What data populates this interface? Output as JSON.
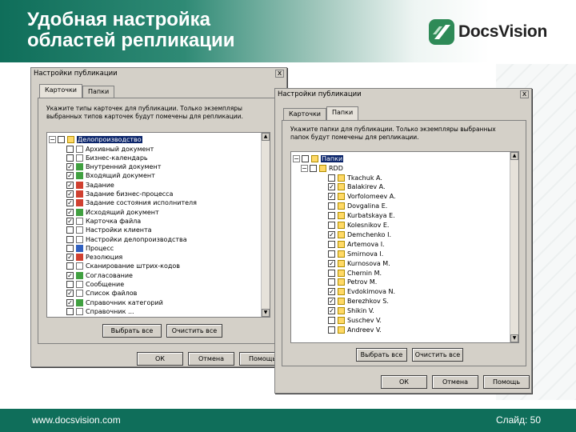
{
  "slide": {
    "title_lines": [
      "Удобная настройка",
      "областей репликации"
    ],
    "logo_text": "DocsVision",
    "footer_url": "www.docsvision.com",
    "footer_page": "Слайд: 50",
    "colors": {
      "brand_green": "#0f6e5a",
      "selection": "#0a246a"
    }
  },
  "dialog_cards": {
    "title": "Настройки публикации",
    "close": "x",
    "tabs": [
      "Карточки",
      "Папки"
    ],
    "active_tab": 0,
    "hint": "Укажите типы карточек для публикации. Только экземпляры выбранных типов карточек будут помечены для репликации.",
    "tree_root": "Делопроизводство",
    "items": [
      {
        "label": "Архивный документ",
        "checked": false,
        "icon": "doc"
      },
      {
        "label": "Бизнес-календарь",
        "checked": false,
        "icon": "doc"
      },
      {
        "label": "Внутренний документ",
        "checked": true,
        "icon": "grn"
      },
      {
        "label": "Входящий документ",
        "checked": true,
        "icon": "grn"
      },
      {
        "label": "Задание",
        "checked": true,
        "icon": "red"
      },
      {
        "label": "Задание бизнес-процесса",
        "checked": true,
        "icon": "red"
      },
      {
        "label": "Задание состояния исполнителя",
        "checked": true,
        "icon": "red"
      },
      {
        "label": "Исходящий документ",
        "checked": true,
        "icon": "grn"
      },
      {
        "label": "Карточка файла",
        "checked": true,
        "icon": "doc"
      },
      {
        "label": "Настройки клиента",
        "checked": false,
        "icon": "doc"
      },
      {
        "label": "Настройки делопроизводства",
        "checked": false,
        "icon": "doc"
      },
      {
        "label": "Процесс",
        "checked": false,
        "icon": "blu"
      },
      {
        "label": "Резолюция",
        "checked": true,
        "icon": "red"
      },
      {
        "label": "Сканирование штрих-кодов",
        "checked": false,
        "icon": "doc"
      },
      {
        "label": "Согласование",
        "checked": true,
        "icon": "grn"
      },
      {
        "label": "Сообщение",
        "checked": false,
        "icon": "doc"
      },
      {
        "label": "Список файлов",
        "checked": true,
        "icon": "doc"
      },
      {
        "label": "Справочник категорий",
        "checked": true,
        "icon": "grn"
      },
      {
        "label": "Справочник ...",
        "checked": false,
        "icon": "doc"
      }
    ],
    "select_all": "Выбрать все",
    "clear_all": "Очистить все",
    "ok": "ОК",
    "cancel": "Отмена",
    "help": "Помощь"
  },
  "dialog_folders": {
    "title": "Настройки публикации",
    "close": "x",
    "tabs": [
      "Карточки",
      "Папки"
    ],
    "active_tab": 1,
    "hint": "Укажите папки для публикации. Только экземпляры выбранных папок будут помечены для репликации.",
    "root": "Папки",
    "sub": "RDD",
    "items": [
      {
        "label": "Tkachuk A.",
        "checked": false
      },
      {
        "label": "Balakirev A.",
        "checked": true
      },
      {
        "label": "Vorfolomeev A.",
        "checked": true
      },
      {
        "label": "Dovgalina E.",
        "checked": false
      },
      {
        "label": "Kurbatskaya E.",
        "checked": false
      },
      {
        "label": "Kolesnikov E.",
        "checked": false
      },
      {
        "label": "Demchenko I.",
        "checked": true
      },
      {
        "label": "Artemova I.",
        "checked": false
      },
      {
        "label": "Smirnova I.",
        "checked": false
      },
      {
        "label": "Kurnosova M.",
        "checked": true
      },
      {
        "label": "Chernin M.",
        "checked": false
      },
      {
        "label": "Petrov M.",
        "checked": false
      },
      {
        "label": "Evdokimova N.",
        "checked": true
      },
      {
        "label": "Berezhkov S.",
        "checked": true
      },
      {
        "label": "Shikin V.",
        "checked": true
      },
      {
        "label": "Suschev V.",
        "checked": false
      },
      {
        "label": "Andreev V.",
        "checked": false
      }
    ],
    "select_all": "Выбрать все",
    "clear_all": "Очистить все",
    "ok": "ОК",
    "cancel": "Отмена",
    "help": "Помощь"
  }
}
